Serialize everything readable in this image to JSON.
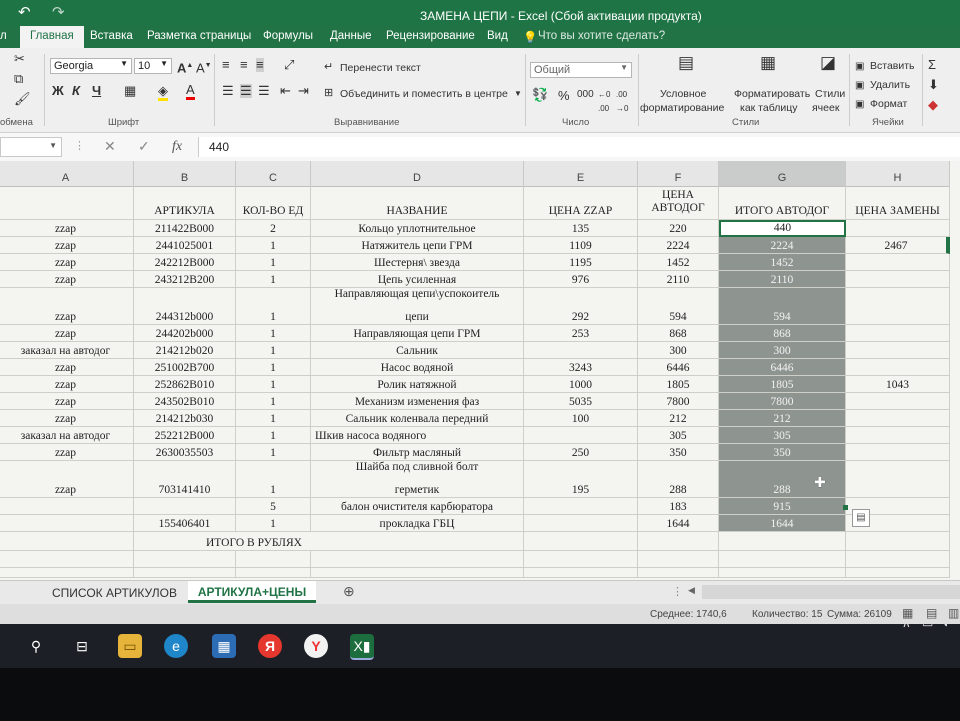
{
  "window": {
    "title": "ЗАМЕНА ЦЕПИ - Excel (Сбой активации продукта)"
  },
  "tabs": [
    {
      "label": "л",
      "active": false
    },
    {
      "label": "Главная",
      "active": true
    },
    {
      "label": "Вставка",
      "active": false
    },
    {
      "label": "Разметка страницы",
      "active": false
    },
    {
      "label": "Формулы",
      "active": false
    },
    {
      "label": "Данные",
      "active": false
    },
    {
      "label": "Рецензирование",
      "active": false
    },
    {
      "label": "Вид",
      "active": false
    }
  ],
  "tell_me": "Что вы хотите сделать?",
  "ribbon": {
    "font_name": "Georgia",
    "font_size": "10",
    "bold": "Ж",
    "italic": "К",
    "underline": "Ч",
    "wrap_text": "Перенести текст",
    "merge_center": "Объединить и поместить в центре",
    "number_format": "Общий",
    "percent": "%",
    "thousands": "000",
    "cond_format_1": "Условное",
    "cond_format_2": "форматирование",
    "format_table_1": "Форматировать",
    "format_table_2": "как таблицу",
    "styles_1": "Стили",
    "styles_2": "ячеек",
    "insert": "Вставить",
    "delete": "Удалить",
    "format": "Формат",
    "groups": {
      "clipboard": "обмена",
      "font": "Шрифт",
      "alignment": "Выравнивание",
      "number": "Число",
      "styles": "Стили",
      "cells": "Ячейки"
    }
  },
  "formula_bar": {
    "fx": "fx",
    "value": "440"
  },
  "columns": [
    "A",
    "B",
    "C",
    "D",
    "E",
    "F",
    "G",
    "H"
  ],
  "headers": {
    "B": "АРТИКУЛА",
    "C": "КОЛ-ВО ЕД",
    "D": "НАЗВАНИЕ",
    "E": "ЦЕНА ZZAP",
    "F": "ЦЕНА АВТОДОГ",
    "G": "ИТОГО АВТОДОГ",
    "H": "ЦЕНА ЗАМЕНЫ"
  },
  "rows": [
    {
      "a": "zzap",
      "b": "211422B000",
      "c": "2",
      "d": "Кольцо уплотнительное",
      "e": "135",
      "f": "220",
      "g": "440",
      "h": ""
    },
    {
      "a": "zzap",
      "b": "2441025001",
      "c": "1",
      "d": "Натяжитель цепи ГРМ",
      "e": "1109",
      "f": "2224",
      "g": "2224",
      "h": "2467"
    },
    {
      "a": "zzap",
      "b": "242212B000",
      "c": "1",
      "d": "Шестерня\\ звезда",
      "e": "1195",
      "f": "1452",
      "g": "1452",
      "h": ""
    },
    {
      "a": "zzap",
      "b": "243212B200",
      "c": "1",
      "d": "Цепь усиленная",
      "e": "976",
      "f": "2110",
      "g": "2110",
      "h": ""
    },
    {
      "a": "zzap",
      "b": "244312b000",
      "c": "1",
      "d": "Направляющая цепи\\успокоитель",
      "d2": "цепи",
      "e": "292",
      "f": "594",
      "g": "594",
      "h": ""
    },
    {
      "a": "zzap",
      "b": "244202b000",
      "c": "1",
      "d": "Направляющая цепи ГРМ",
      "e": "253",
      "f": "868",
      "g": "868",
      "h": ""
    },
    {
      "a": "заказал на автодог",
      "b": "214212b020",
      "c": "1",
      "d": "Сальник",
      "e": "",
      "f": "300",
      "g": "300",
      "h": ""
    },
    {
      "a": "zzap",
      "b": "251002B700",
      "c": "1",
      "d": "Насос водяной",
      "e": "3243",
      "f": "6446",
      "g": "6446",
      "h": ""
    },
    {
      "a": "zzap",
      "b": "252862B010",
      "c": "1",
      "d": "Ролик натяжной",
      "e": "1000",
      "f": "1805",
      "g": "1805",
      "h": "1043"
    },
    {
      "a": "zzap",
      "b": "243502B010",
      "c": "1",
      "d": "Механизм изменения фаз",
      "e": "5035",
      "f": "7800",
      "g": "7800",
      "h": ""
    },
    {
      "a": "zzap",
      "b": "214212b030",
      "c": "1",
      "d": "Сальник коленвала передний",
      "e": "100",
      "f": "212",
      "g": "212",
      "h": ""
    },
    {
      "a": "заказал на автодог",
      "b": "252212B000",
      "c": "1",
      "d": "Шкив насоса водяного",
      "e": "",
      "f": "305",
      "g": "305",
      "h": ""
    },
    {
      "a": "zzap",
      "b": "2630035503",
      "c": "1",
      "d": "Фильтр масляный",
      "e": "250",
      "f": "350",
      "g": "350",
      "h": ""
    },
    {
      "a": "zzap",
      "b": "703141410",
      "c": "1",
      "d": "Шайба под сливной болт",
      "d2": "герметик",
      "e": "195",
      "f": "288",
      "g": "288",
      "h": ""
    },
    {
      "a": "",
      "b": "",
      "c": "5",
      "d": "балон очистителя карбюратора",
      "e": "",
      "f": "183",
      "g": "915",
      "h": ""
    },
    {
      "a": "",
      "b": "155406401",
      "c": "1",
      "d": "прокладка ГБЦ",
      "e": "",
      "f": "1644",
      "g": "1644",
      "h": ""
    }
  ],
  "total_label": "ИТОГО В РУБЛЯХ",
  "sheets": [
    {
      "label": "СПИСОК АРТИКУЛОВ",
      "active": false
    },
    {
      "label": "АРТИКУЛА+ЦЕНЫ",
      "active": true
    }
  ],
  "status": {
    "average": "Среднее: 1740,6",
    "count": "Количество: 15",
    "sum": "Сумма: 26109"
  },
  "colors": {
    "excel_green": "#217346",
    "selection": "#8e9591"
  }
}
